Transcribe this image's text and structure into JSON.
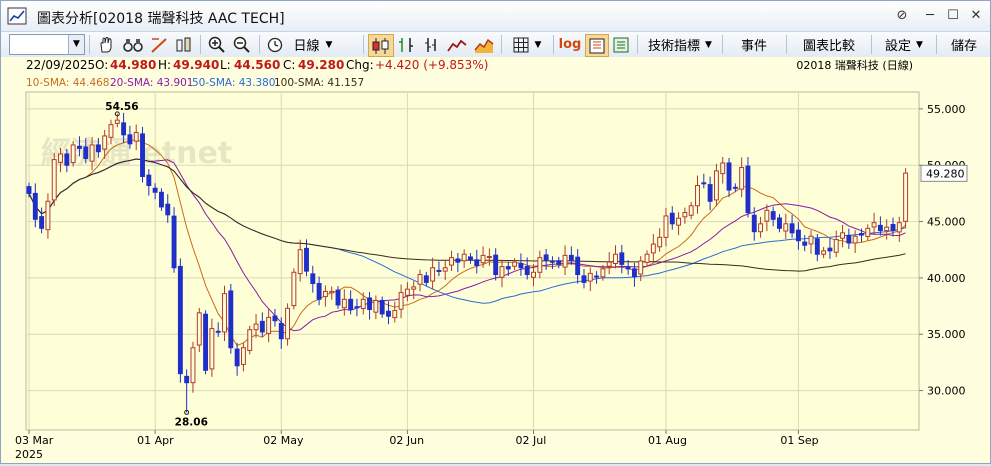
{
  "window": {
    "title": "圖表分析[02018 瑞聲科技 AAC TECH]",
    "controls": [
      "⊘",
      "─",
      "☐",
      "✕"
    ]
  },
  "toolbar": {
    "combo_value": "",
    "period_label": "日線",
    "log_label": "log",
    "indicators_label": "技術指標",
    "events_label": "事件",
    "compare_label": "圖表比較",
    "settings_label": "設定",
    "save_label": "儲存"
  },
  "info": {
    "date": "22/09/2025",
    "open_label": "O:",
    "open": "44.980",
    "high_label": "H:",
    "high": "49.940",
    "low_label": "L:",
    "low": "44.560",
    "close_label": "C:",
    "close": "49.280",
    "chg_label": "Chg:",
    "chg": "+4.420 (+9.853%)",
    "symbol": "02018  瑞聲科技 (日線)"
  },
  "legend": {
    "sma10": "10-SMA: 44.468",
    "sma20": "20-SMA: 43.901",
    "sma50": "50-SMA: 43.380",
    "sma100": "100-SMA: 41.157"
  },
  "watermark": "經濟通 etnet",
  "colors": {
    "plot_bg": "#ffffd7",
    "up": "#b23a2a",
    "down": "#1f2fc8",
    "sma10": "#cc6a1a",
    "sma20": "#8a1aa8",
    "sma50": "#2a6ad6",
    "sma100": "#3a2a1a",
    "chg": "#c01818"
  },
  "chart_data": {
    "type": "candlestick",
    "ylim": [
      26.5,
      56.5
    ],
    "ytick_labels": [
      "55.000",
      "50.000",
      "45.000",
      "40.000",
      "35.000",
      "30.000"
    ],
    "yticks": [
      55,
      50,
      45,
      40,
      35,
      30
    ],
    "last_price_label": "49.280",
    "last_price": 49.28,
    "x_labels": [
      {
        "text": "03 Mar",
        "index": 0
      },
      {
        "text": "01 Apr",
        "index": 20
      },
      {
        "text": "02 May",
        "index": 40
      },
      {
        "text": "02 Jun",
        "index": 60
      },
      {
        "text": "02 Jul",
        "index": 80
      },
      {
        "text": "01 Aug",
        "index": 101
      },
      {
        "text": "01 Sep",
        "index": 122
      }
    ],
    "year_label": "2025",
    "high_marker": {
      "text": "54.56",
      "index": 14,
      "value": 54.56
    },
    "low_marker": {
      "text": "28.06",
      "index": 25,
      "value": 28.06
    },
    "closes": [
      47.5,
      45.2,
      44.4,
      46.8,
      50.5,
      51.0,
      50.0,
      51.8,
      51.5,
      50.6,
      51.8,
      51.2,
      52.6,
      53.6,
      54.0,
      52.7,
      51.9,
      52.9,
      49.0,
      48.2,
      47.6,
      46.3,
      45.6,
      40.9,
      31.5,
      30.7,
      33.8,
      36.9,
      31.8,
      35.5,
      35.2,
      38.6,
      33.8,
      32.2,
      33.8,
      35.4,
      35.9,
      35.2,
      36.5,
      36.2,
      34.6,
      37.3,
      40.5,
      42.5,
      40.6,
      39.5,
      38.1,
      38.8,
      38.8,
      37.6,
      38.1,
      37.2,
      37.4,
      38.1,
      37.2,
      38.0,
      36.8,
      36.6,
      37.1,
      38.7,
      39.0,
      39.2,
      40.3,
      39.6,
      40.9,
      40.6,
      40.9,
      41.8,
      41.4,
      42.1,
      41.6,
      41.1,
      42.0,
      41.9,
      40.3,
      41.0,
      40.8,
      41.4,
      40.9,
      40.3,
      40.5,
      41.8,
      41.6,
      41.4,
      41.2,
      42.0,
      41.6,
      40.3,
      39.6,
      40.4,
      40.1,
      40.8,
      41.4,
      42.1,
      41.2,
      40.8,
      40.1,
      41.5,
      42.1,
      43.0,
      43.6,
      45.5,
      44.8,
      45.3,
      45.8,
      46.4,
      48.2,
      48.4,
      46.8,
      49.5,
      50.2,
      47.8,
      48.0,
      49.8,
      45.8,
      44.1,
      44.8,
      46.0,
      45.2,
      44.4,
      44.8,
      44.0,
      43.3,
      42.9,
      43.7,
      42.1,
      42.4,
      42.4,
      43.4,
      44.0,
      43.1,
      43.7,
      43.8,
      44.4,
      44.9,
      44.2,
      44.5,
      44.2,
      44.9,
      49.3
    ],
    "x_count": 138
  }
}
